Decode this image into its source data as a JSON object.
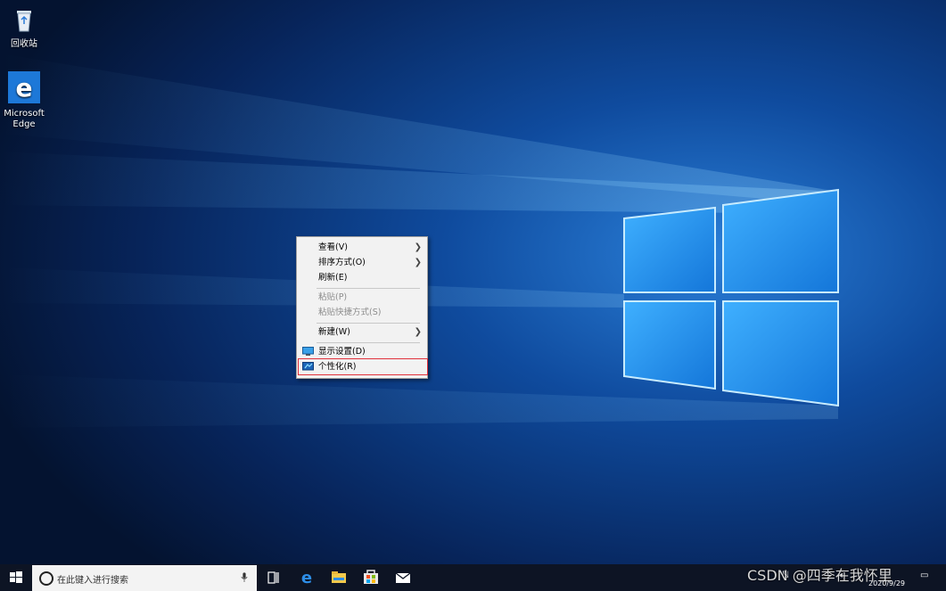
{
  "desktop": {
    "icons": [
      {
        "label": "回收站"
      },
      {
        "label_line1": "Microsoft",
        "label_line2": "Edge"
      }
    ]
  },
  "context_menu": {
    "items": [
      {
        "label": "查看(V)",
        "submenu": true
      },
      {
        "label": "排序方式(O)",
        "submenu": true
      },
      {
        "label": "刷新(E)"
      },
      {
        "label": "粘贴(P)",
        "disabled": true
      },
      {
        "label": "粘贴快捷方式(S)",
        "disabled": true
      },
      {
        "label": "新建(W)",
        "submenu": true
      },
      {
        "label": "显示设置(D)",
        "icon": "display-icon"
      },
      {
        "label": "个性化(R)",
        "icon": "personalize-icon",
        "highlighted": true
      }
    ],
    "submenu_arrow": "❯",
    "highlight_color": "#e0303a"
  },
  "taskbar": {
    "search_placeholder": "在此键入进行搜索",
    "pinned": [
      "task-view-icon",
      "edge-icon",
      "file-explorer-icon",
      "store-icon",
      "mail-icon"
    ],
    "watermark": "CSDN @四季在我怀里",
    "date": "2020/9/29"
  },
  "colors": {
    "wallpaper": "#0a2e6a",
    "accent_light": "#5bc8ff",
    "taskbar": "#0d1424"
  }
}
